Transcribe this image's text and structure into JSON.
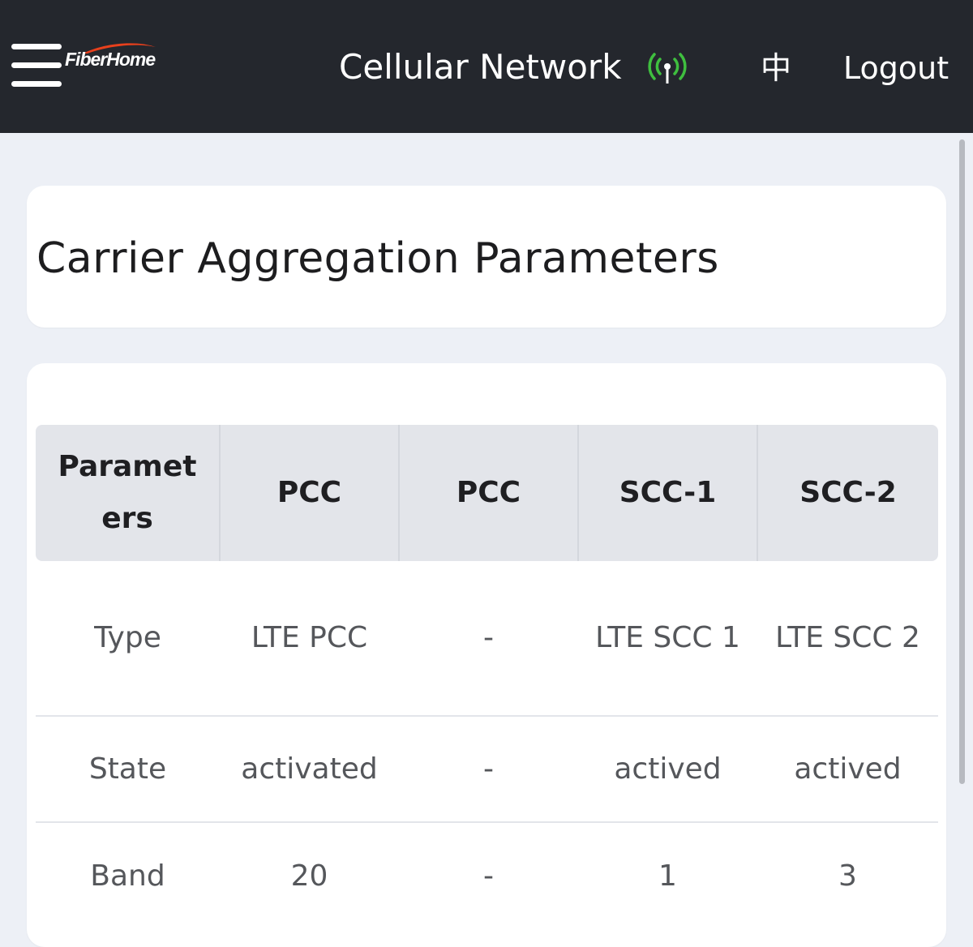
{
  "header": {
    "logo_text": "FiberHome",
    "title": "Cellular Network",
    "language_toggle": "中",
    "logout_label": "Logout",
    "signal_icon": "signal-antenna-icon",
    "signal_color": "#3fbf3f"
  },
  "page": {
    "title": "Carrier Aggregation Parameters"
  },
  "table": {
    "headers": [
      "Paramet ers",
      "PCC",
      "PCC",
      "SCC-1",
      "SCC-2"
    ],
    "rows": [
      {
        "name": "Type",
        "cells": [
          "LTE PCC",
          "-",
          "LTE SCC 1",
          "LTE SCC 2"
        ]
      },
      {
        "name": "State",
        "cells": [
          "activated",
          "-",
          "actived",
          "actived"
        ]
      },
      {
        "name": "Band",
        "cells": [
          "20",
          "-",
          "1",
          "3"
        ]
      }
    ]
  },
  "colors": {
    "topbar": "#24272d",
    "background": "#edf0f6",
    "table_header": "#e3e5ea",
    "logo_swoosh": "#e8401c"
  }
}
